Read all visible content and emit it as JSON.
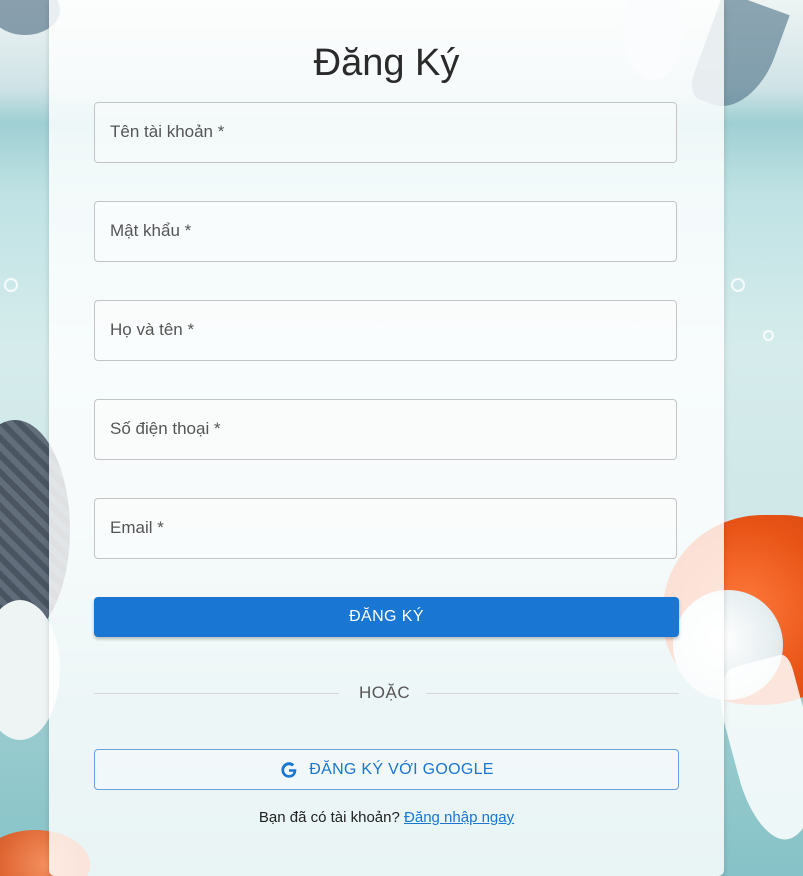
{
  "form": {
    "title": "Đăng Ký",
    "fields": [
      {
        "label": "Tên tài khoản *"
      },
      {
        "label": "Mật khẩu *"
      },
      {
        "label": "Họ và tên *"
      },
      {
        "label": "Số điện thoại *"
      },
      {
        "label": "Email *"
      }
    ],
    "submit_label": "ĐĂNG KÝ",
    "divider_label": "HOẶC",
    "google_label": "ĐĂNG KÝ VỚI GOOGLE",
    "footer_text": "Bạn đã có tài khoản?",
    "login_link": "Đăng nhập ngay"
  },
  "colors": {
    "primary": "#1976d2",
    "google_icon": "#1976d2"
  },
  "icons": [
    "google-icon"
  ]
}
